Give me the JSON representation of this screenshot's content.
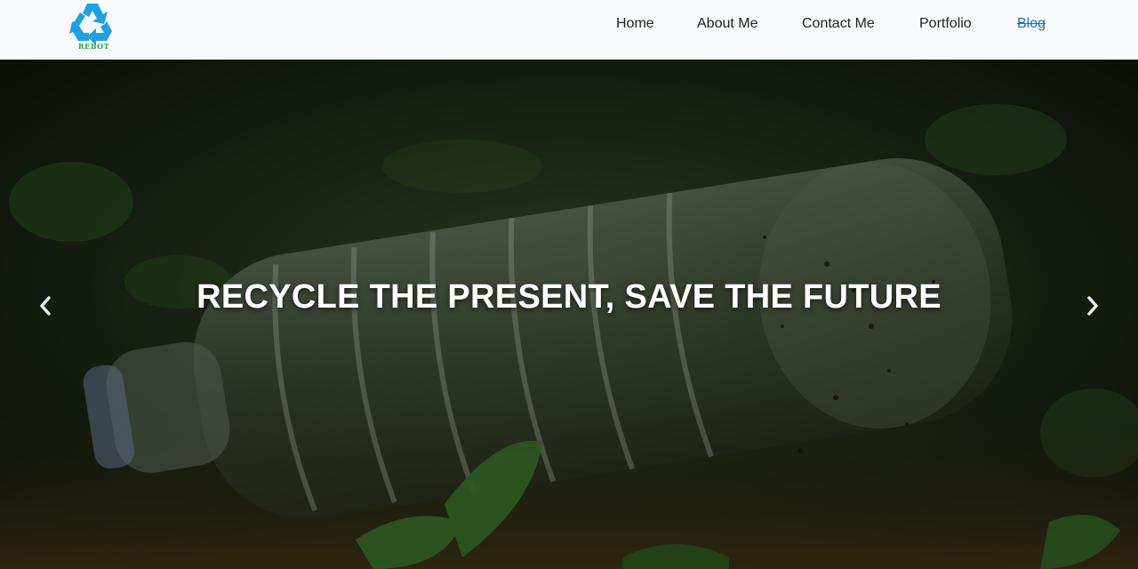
{
  "brand": {
    "logo_text": "REBOT",
    "color": "#1da1e6"
  },
  "nav": {
    "items": [
      {
        "label": "Home"
      },
      {
        "label": "About Me"
      },
      {
        "label": "Contact Me"
      },
      {
        "label": "Portfolio"
      },
      {
        "label": "Blog"
      }
    ]
  },
  "hero": {
    "title": "RECYCLE THE PRESENT, SAVE THE FUTURE",
    "prev_icon": "chevron-left-icon",
    "next_icon": "chevron-right-icon"
  }
}
